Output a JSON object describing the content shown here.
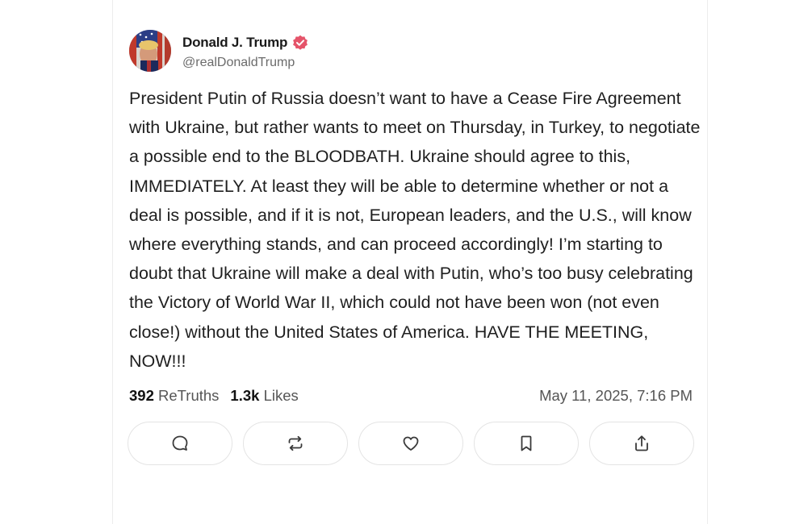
{
  "author": {
    "display_name": "Donald J. Trump",
    "handle": "@realDonaldTrump",
    "verified": true,
    "verified_color": "#e5546a"
  },
  "post": {
    "text": "President Putin of Russia doesn’t want to have a Cease Fire Agreement with Ukraine, but rather wants to meet on Thursday, in Turkey, to negotiate a possible end to the BLOODBATH. Ukraine should agree to this, IMMEDIATELY. At least they will be able to determine whether or not a deal is possible, and if it is not, European leaders, and the U.S., will know where everything stands, and can proceed accordingly! I’m starting to doubt that Ukraine will make a deal with Putin, who’s too busy celebrating the Victory of World War II, which could not have been won (not even close!) without the United States of America. HAVE THE MEETING, NOW!!!"
  },
  "stats": {
    "retruths_count": "392",
    "retruths_label": "ReTruths",
    "likes_count": "1.3k",
    "likes_label": "Likes",
    "timestamp": "May 11, 2025, 7:16 PM"
  },
  "actions": [
    {
      "icon": "reply-icon"
    },
    {
      "icon": "retruth-icon"
    },
    {
      "icon": "heart-icon"
    },
    {
      "icon": "bookmark-icon"
    },
    {
      "icon": "share-icon"
    }
  ]
}
